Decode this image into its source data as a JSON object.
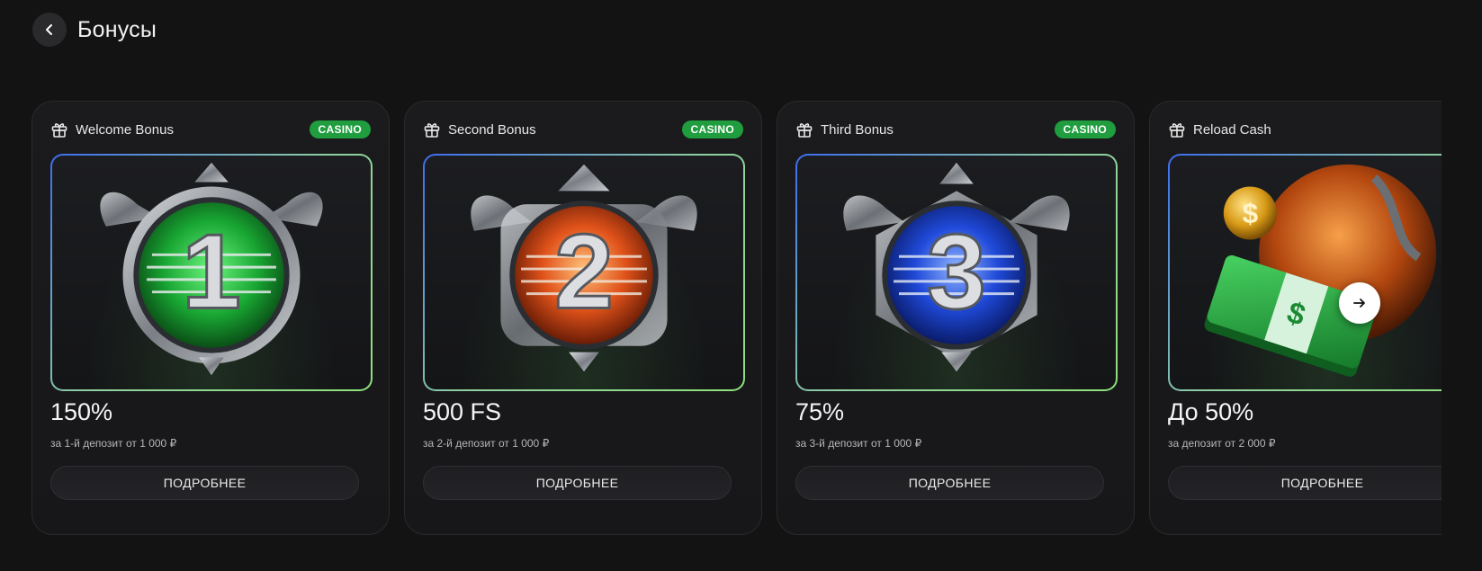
{
  "header": {
    "title": "Бонусы",
    "back_icon": "chevron-left-icon"
  },
  "bonuses": [
    {
      "name": "Welcome Bonus",
      "tag": "CASINO",
      "amount": "150%",
      "condition": "за 1-й депозит от 1 000 ₽",
      "button": "ПОДРОБНЕЕ",
      "badge_number": "1",
      "accent": "#22b84a"
    },
    {
      "name": "Second Bonus",
      "tag": "CASINO",
      "amount": "500 FS",
      "condition": "за 2-й депозит от 1 000 ₽",
      "button": "ПОДРОБНЕЕ",
      "badge_number": "2",
      "accent": "#e5621c"
    },
    {
      "name": "Third Bonus",
      "tag": "CASINO",
      "amount": "75%",
      "condition": "за 3-й депозит от 1 000 ₽",
      "button": "ПОДРОБНЕЕ",
      "badge_number": "3",
      "accent": "#2a5bea"
    },
    {
      "name": "Reload Cash",
      "amount": "До 50%",
      "condition": "за депозит от 2 000 ₽",
      "button": "ПОДРОБНЕЕ",
      "accent": "#2fbf4a",
      "coin_symbol": "$",
      "cash_symbol": "$"
    }
  ],
  "carousel": {
    "next_icon": "arrow-right-icon"
  },
  "colors": {
    "background": "#131314",
    "card": "#1b1b1d",
    "badge": "#1f9d3f"
  }
}
